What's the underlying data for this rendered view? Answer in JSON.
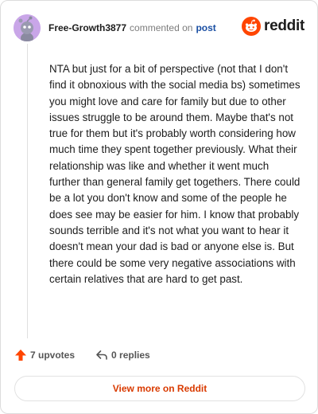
{
  "header": {
    "username": "Free-Growth3877",
    "action": "commented on",
    "post_link": "post",
    "brand": "reddit"
  },
  "comment": {
    "text": "NTA but just for a bit of perspective (not that I don't find it obnoxious with the social media bs) sometimes you might love and care for family but due to other issues struggle to be around them. Maybe that's not true for them but it's probably worth considering how much time they spent together previously. What their relationship was like and whether it went much further than general family get togethers. There could be a lot you don't know and some of the people he does see may be easier for him. I know that probably sounds terrible and it's not what you want to hear it doesn't mean your dad is bad or anyone else is. But there could be some very negative associations with certain relatives that are hard to get past."
  },
  "footer": {
    "upvotes": "7 upvotes",
    "replies": "0 replies",
    "view_more": "View more on Reddit"
  },
  "colors": {
    "accent": "#ff4500",
    "link": "#1a4fa3",
    "avatar_bg": "#c9a6e8"
  },
  "icons": [
    "snoo-avatar-icon",
    "reddit-logo-icon",
    "upvote-arrow-icon",
    "reply-arrow-icon"
  ]
}
